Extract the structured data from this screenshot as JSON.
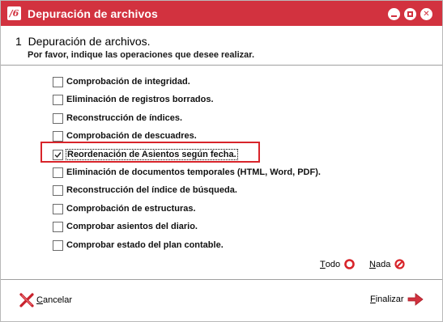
{
  "window": {
    "title": "Depuración de archivos",
    "app_logo": "/6"
  },
  "header": {
    "step_title": "1  Depuración de archivos.",
    "subtitle": "Por favor, indique las operaciones que desee realizar."
  },
  "options": [
    {
      "label": "Comprobación de integridad.",
      "checked": false
    },
    {
      "label": "Eliminación de registros borrados.",
      "checked": false
    },
    {
      "label": "Reconstrucción de índices.",
      "checked": false
    },
    {
      "label": "Comprobación de descuadres.",
      "checked": false
    },
    {
      "label": "Reordenación de Asientos según fecha.",
      "checked": true
    },
    {
      "label": "Eliminación de documentos temporales (HTML, Word, PDF).",
      "checked": false
    },
    {
      "label": "Reconstrucción del índice de búsqueda.",
      "checked": false
    },
    {
      "label": "Comprobación de estructuras.",
      "checked": false
    },
    {
      "label": "Comprobar asientos del diario.",
      "checked": false
    },
    {
      "label": "Comprobar estado del plan contable.",
      "checked": false
    }
  ],
  "selection": {
    "all_key": "T",
    "all_rest": "odo",
    "none_key": "N",
    "none_rest": "ada"
  },
  "footer": {
    "cancel_key": "C",
    "cancel_rest": "ancelar",
    "finish_key": "F",
    "finish_rest": "inalizar"
  },
  "colors": {
    "titlebar": "#d2323f",
    "highlight": "#d8242a"
  },
  "icons": {
    "app": "app-logo-icon",
    "minimize": "minimize-icon",
    "maximize": "maximize-icon",
    "close": "close-icon",
    "select_all": "select-all-icon",
    "select_none": "select-none-icon",
    "cancel": "cancel-x-icon",
    "finish": "arrow-right-icon"
  }
}
